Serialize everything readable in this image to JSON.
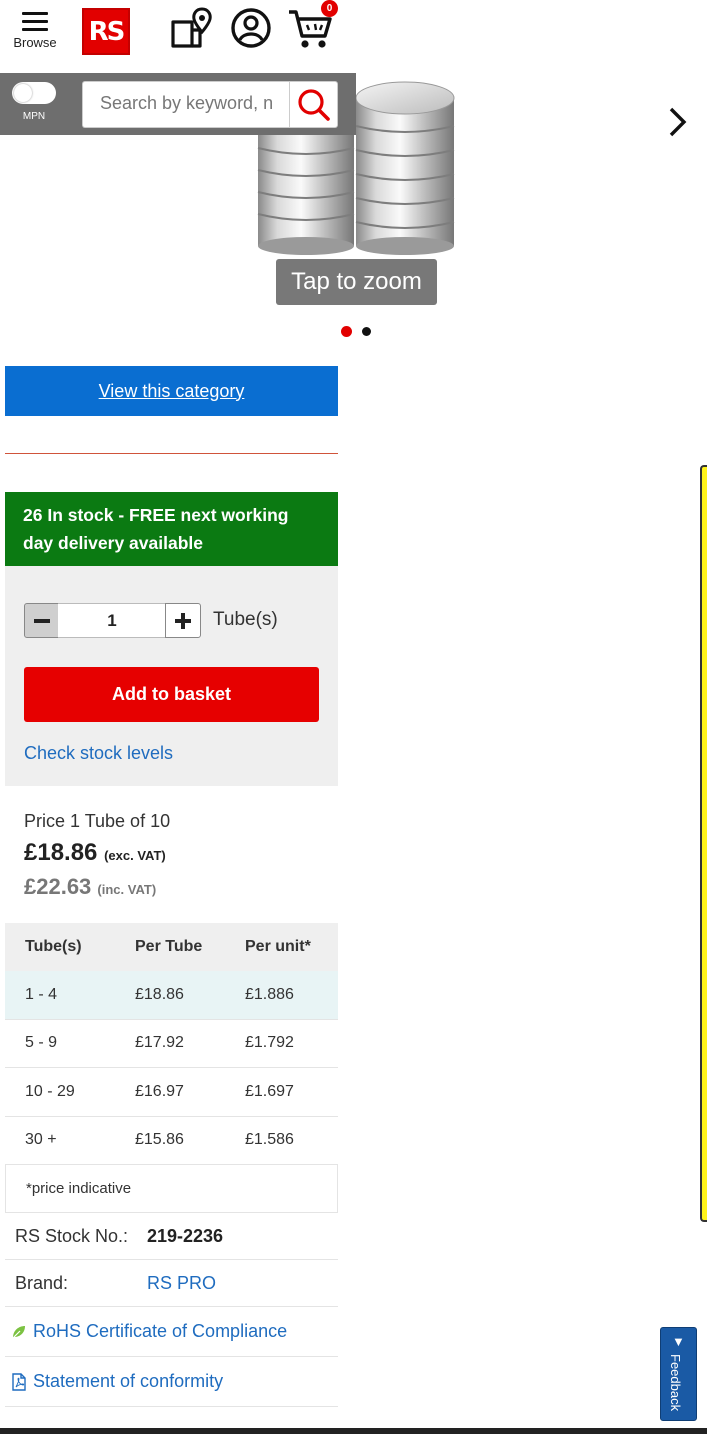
{
  "header": {
    "browse_label": "Browse",
    "logo_text": "RS",
    "cart_count": "0"
  },
  "search": {
    "mpn_label": "MPN",
    "placeholder": "Search by keyword, n"
  },
  "gallery": {
    "tap_to_zoom": "Tap to zoom",
    "dots": 2,
    "active_dot": 1
  },
  "category": {
    "view_label": "View this category"
  },
  "stock": {
    "message": "26 In stock - FREE next working day delivery available",
    "quantity": "1",
    "unit_label": "Tube(s)",
    "add_label": "Add to basket",
    "check_label": "Check stock levels"
  },
  "price": {
    "line": "Price 1 Tube of 10",
    "exc_value": "£18.86",
    "exc_label": "(exc. VAT)",
    "inc_value": "£22.63",
    "inc_label": "(inc. VAT)"
  },
  "price_table": {
    "headers": [
      "Tube(s)",
      "Per Tube",
      "Per unit*"
    ],
    "rows": [
      [
        "1 - 4",
        "£18.86",
        "£1.886"
      ],
      [
        "5 - 9",
        "£17.92",
        "£1.792"
      ],
      [
        "10 - 29",
        "£16.97",
        "£1.697"
      ],
      [
        "30 +",
        "£15.86",
        "£1.586"
      ]
    ],
    "note": "*price indicative"
  },
  "details": {
    "stock_no_label": "RS Stock No.:",
    "stock_no_value": "219-2236",
    "brand_label": "Brand:",
    "brand_value": "RS PRO",
    "rohs_label": "RoHS Certificate of Compliance",
    "conformity_label": "Statement of conformity"
  },
  "feedback": {
    "label": "Feedback"
  },
  "colors": {
    "brand_red": "#e20000",
    "category_blue": "#0a6ed1",
    "stock_green": "#0b7a12",
    "link_blue": "#1f6cbf"
  }
}
